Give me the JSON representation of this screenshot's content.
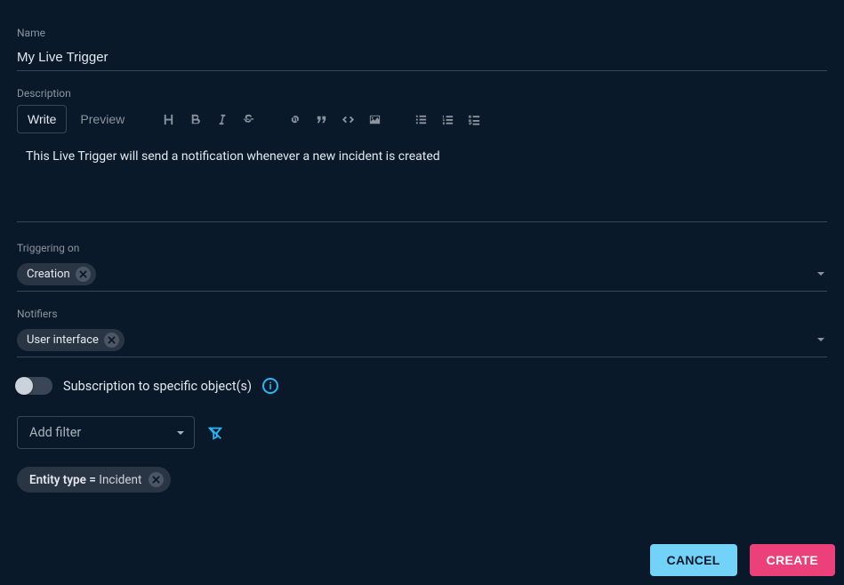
{
  "name": {
    "label": "Name",
    "value": "My Live Trigger"
  },
  "description": {
    "label": "Description",
    "tabs": {
      "write": "Write",
      "preview": "Preview"
    },
    "value": "This Live Trigger will send a notification whenever a new incident is created"
  },
  "triggering": {
    "label": "Triggering on",
    "chips": [
      "Creation"
    ]
  },
  "notifiers": {
    "label": "Notifiers",
    "chips": [
      "User interface"
    ]
  },
  "subscription": {
    "label": "Subscription to specific object(s)",
    "enabled": false
  },
  "filter": {
    "addLabel": "Add filter",
    "applied": {
      "key": "Entity type =",
      "value": "Incident"
    }
  },
  "actions": {
    "cancel": "CANCEL",
    "create": "CREATE"
  }
}
